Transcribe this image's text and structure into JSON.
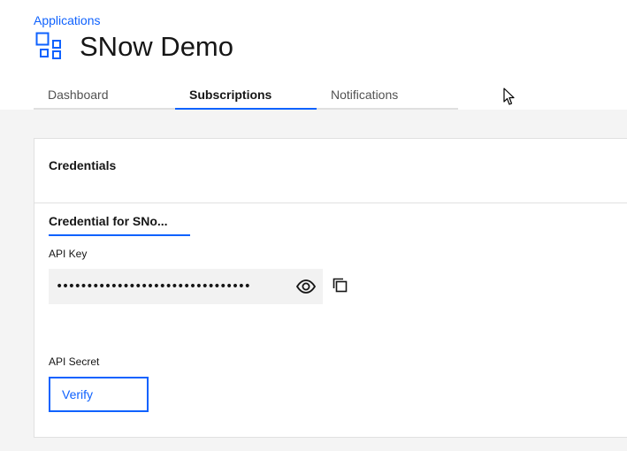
{
  "breadcrumb": {
    "label": "Applications"
  },
  "app": {
    "title": "SNow Demo",
    "icon": "application-icon"
  },
  "tabs": [
    {
      "label": "Dashboard",
      "active": false
    },
    {
      "label": "Subscriptions",
      "active": true
    },
    {
      "label": "Notifications",
      "active": false
    }
  ],
  "credentials": {
    "title": "Credentials",
    "tab_label": "Credential for SNo...",
    "api_key_label": "API Key",
    "api_key_value": "••••••••••••••••••••••••••••••••",
    "api_secret_label": "API Secret",
    "verify_label": "Verify"
  },
  "icons": {
    "show_password": "eye-icon",
    "copy": "copy-icon"
  },
  "colors": {
    "accent": "#0f62fe",
    "background": "#f4f4f4",
    "field": "#f2f2f2"
  }
}
